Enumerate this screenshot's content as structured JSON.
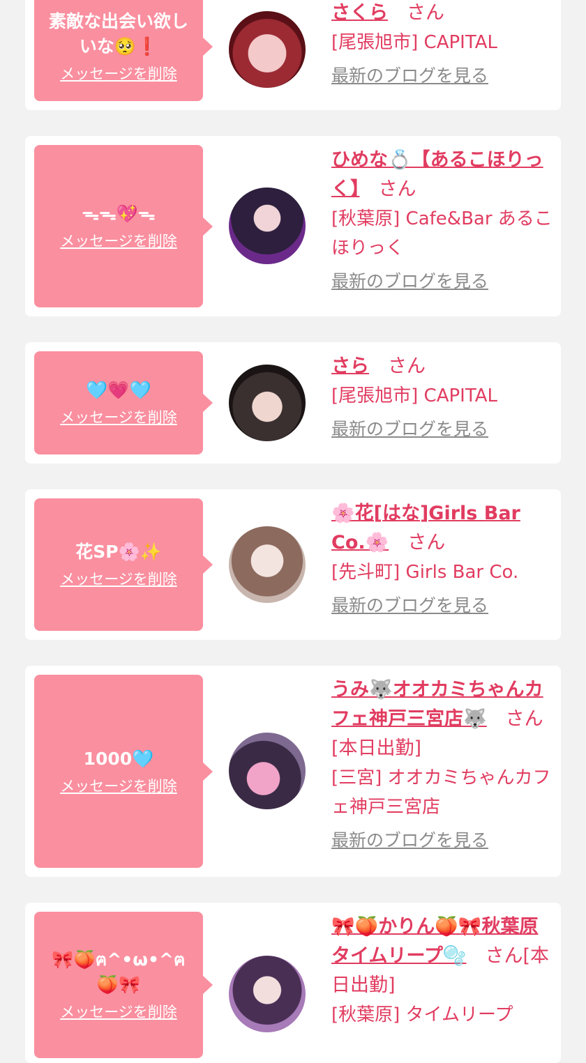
{
  "delete_label": "メッセージを削除",
  "blog_label": "最新のブログを見る",
  "san_label": "さん",
  "colors": {
    "bubble": "#fa8f9f",
    "accent": "#e13c60",
    "link_gray": "#8a8a8a",
    "bg": "#f2f2f2"
  },
  "entries": [
    {
      "message": "素敵な出会い欲しいな🥺❗",
      "name": "さくら",
      "suffix": "",
      "shop": "[尾張旭市] CAPITAL"
    },
    {
      "message": "ᯓᯓ💖ᯓ",
      "name": "ひめな💍【あるこほりっく】",
      "suffix": "",
      "shop": "[秋葉原] Cafe&Bar あるこほりっく"
    },
    {
      "message": "🩵💗🩵",
      "name": "さら",
      "suffix": "",
      "shop": "[尾張旭市] CAPITAL"
    },
    {
      "message": "花SP🌸✨",
      "name": "🌸花[はな]Girls Bar Co.🌸",
      "suffix": "",
      "shop": "[先斗町] Girls Bar Co."
    },
    {
      "message": "1000🩵",
      "name": "うみ🐺オオカミちゃんカフェ神戸三宮店🐺",
      "suffix": "[本日出勤]",
      "shop": "[三宮] オオカミちゃんカフェ神戸三宮店"
    },
    {
      "message": "🎀🍑ฅ^•ω•^ฅ🍑🎀",
      "name": "🎀🍑かりん🍑🎀秋葉原タイムリープ🫧",
      "suffix": "[本日出勤]",
      "shop": "[秋葉原] タイムリープ"
    }
  ]
}
